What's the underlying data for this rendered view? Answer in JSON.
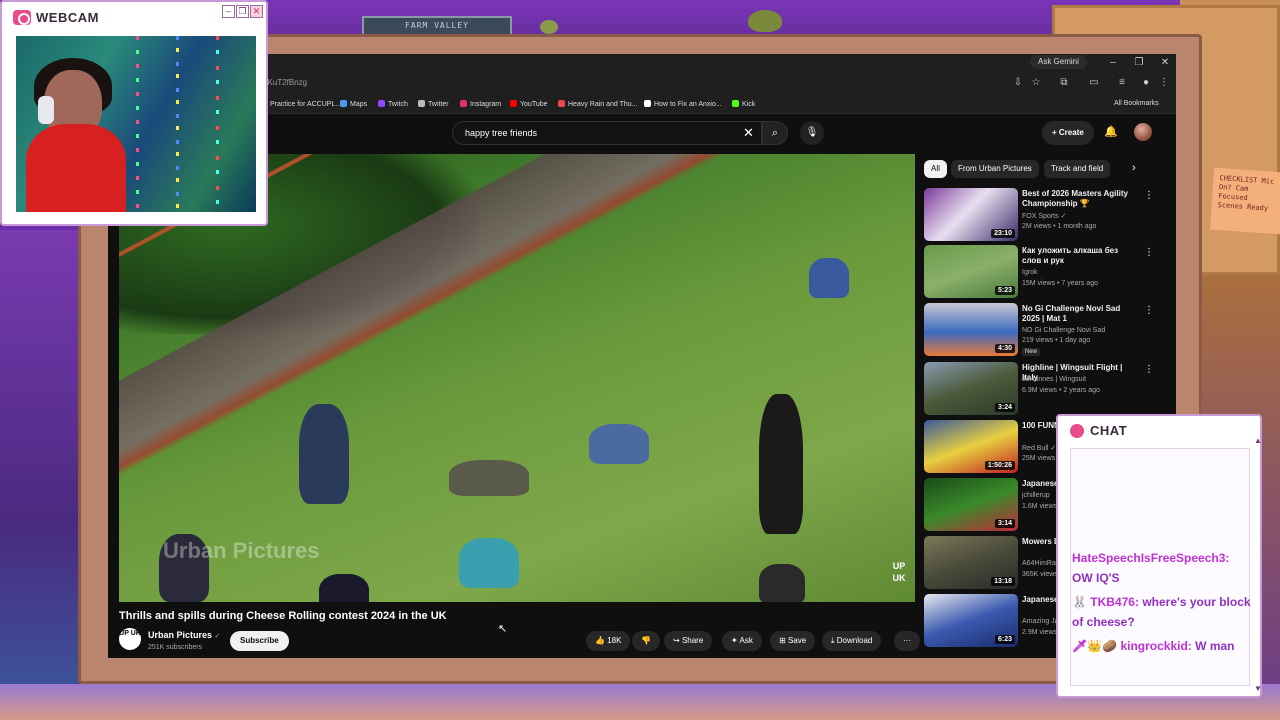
{
  "scene": {
    "sign_text": "FARM VALLEY",
    "note_text": "CHECKLIST Mic On? Cam Focused Scenes Ready"
  },
  "webcam": {
    "title": "WEBCAM",
    "btn_min": "–",
    "btn_max": "❐",
    "btn_close": "✕"
  },
  "browser": {
    "ask_gemini": "Ask Gemini",
    "url": "siRKuT2fBnzg",
    "win_min": "–",
    "win_max": "❐",
    "win_close": "✕",
    "bookmarks": [
      {
        "label": "Practice for ACCUPL...",
        "color": "#e8a030"
      },
      {
        "label": "Maps",
        "color": "#4a9af0"
      },
      {
        "label": "Twitch",
        "color": "#9146ff"
      },
      {
        "label": "Twitter",
        "color": "#bbbbbb"
      },
      {
        "label": "Instagram",
        "color": "#e1306c"
      },
      {
        "label": "YouTube",
        "color": "#ff0000"
      },
      {
        "label": "Heavy Rain and Thu...",
        "color": "#e84a4a"
      },
      {
        "label": "How to Fix an Anxio...",
        "color": "#ffffff"
      },
      {
        "label": "Kick",
        "color": "#53fc18"
      }
    ],
    "all_bookmarks": "All Bookmarks"
  },
  "youtube": {
    "search_value": "happy tree friends",
    "create_label": "Create",
    "video": {
      "title": "Thrills and spills during Cheese Rolling contest 2024 in the UK",
      "watermark": "Urban Pictures",
      "logo_text": "UP UK"
    },
    "channel": {
      "avatar_text": "UP UK",
      "name": "Urban Pictures",
      "verified": "✓",
      "subscribers": "251K subscribers",
      "subscribe_label": "Subscribe"
    },
    "actions": {
      "likes": "18K",
      "share": "Share",
      "ask": "Ask",
      "save": "Save",
      "download": "Download",
      "more": "···"
    },
    "chips": [
      "All",
      "From Urban Pictures",
      "Track and field"
    ],
    "recommendations": [
      {
        "title": "Best of 2026 Masters Agility Championship 🏆 Westminste...",
        "channel": "FOX Sports ✓",
        "meta": "2M views • 1 month ago",
        "duration": "23:10",
        "badge": "",
        "thumb": "linear-gradient(135deg,#7a3a9a 0%,#e8e0f0 45%,#3a2a6a 100%)"
      },
      {
        "title": "Как уложить алкаша без слов и рук",
        "channel": "Igrok",
        "meta": "15M views • 7 years ago",
        "duration": "5:23",
        "badge": "",
        "thumb": "linear-gradient(160deg,#6a9a4a 0%,#8ab06a 50%,#4a7a3a 100%)"
      },
      {
        "title": "No Gi Challenge Novi Sad 2025 | Mat 1",
        "channel": "NO Gi Challenge Novi Sad",
        "meta": "219 views • 1 day ago",
        "duration": "4:30",
        "badge": "New",
        "thumb": "linear-gradient(180deg,#c8c8d0 0%,#3a6ac0 55%,#e87a3a 100%)"
      },
      {
        "title": "Highline | Wingsuit Flight | Italy",
        "channel": "JoHannes | Wingsuit",
        "meta": "6.9M views • 2 years ago",
        "duration": "3:24",
        "badge": "",
        "thumb": "linear-gradient(160deg,#8a9ab0 0%,#4a5a3a 50%,#2a3a2a 100%)"
      },
      {
        "title": "100 FUNNIEST Soapbox Fails",
        "channel": "Red Bull ✓",
        "meta": "25M views",
        "duration": "1:50:26",
        "badge": "",
        "thumb": "linear-gradient(160deg,#3a5a9a 0%,#e8d040 50%,#c02020 100%)"
      },
      {
        "title": "Japanese",
        "channel": "jchillerup",
        "meta": "1.6M views",
        "duration": "3:14",
        "badge": "",
        "thumb": "linear-gradient(160deg,#1a4a1a 0%,#3a8a2a 50%,#c02a3a 100%)"
      },
      {
        "title": "Mowers Derby 2024",
        "channel": "A64HimRac...",
        "meta": "365K views",
        "duration": "13:18",
        "badge": "",
        "thumb": "linear-gradient(160deg,#7a7a5a 0%,#4a4a3a 50%,#2a2a2a 100%)"
      },
      {
        "title": "Japanese Taoshi]",
        "channel": "Amazing Ja...",
        "meta": "2.9M views",
        "duration": "6:23",
        "badge": "",
        "thumb": "linear-gradient(160deg,#e8e8f0 0%,#3a5ab0 50%,#1a2a6a 100%)"
      }
    ]
  },
  "chat": {
    "title": "CHAT",
    "messages": [
      {
        "user": "HateSpeechIsFreeSpeech3:",
        "text": "OW IQ'S"
      },
      {
        "user": "🐰 TKB476:",
        "text": "where's your block of cheese?"
      },
      {
        "user": "🗡👑🥔 kingrockkid:",
        "text": "W man"
      }
    ]
  },
  "colors": {
    "yt_bg": "#0f0f0f",
    "chip_active": "#f1f1f1",
    "overlay_border": "#c89ad8",
    "chat_user": "#c030d8",
    "accent_pink": "#e84a8a"
  }
}
